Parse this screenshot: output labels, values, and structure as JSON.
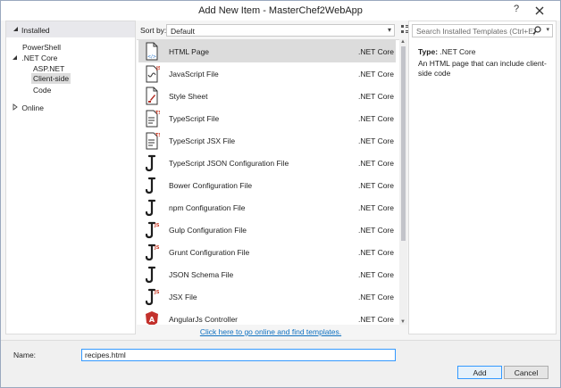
{
  "window": {
    "title": "Add New Item - MasterChef2WebApp",
    "help_label": "?"
  },
  "left": {
    "installed_label": "Installed",
    "tree": [
      {
        "label": "PowerShell"
      },
      {
        "label": ".NET Core"
      },
      {
        "label": "ASP.NET"
      },
      {
        "label": "Client-side"
      },
      {
        "label": "Code"
      },
      {
        "label": "Online"
      }
    ]
  },
  "toolbar": {
    "sort_label": "Sort by:",
    "sort_value": "Default"
  },
  "items": [
    {
      "name": "HTML Page",
      "category": ".NET Core",
      "icon": "html-page-icon"
    },
    {
      "name": "JavaScript File",
      "category": ".NET Core",
      "icon": "javascript-file-icon"
    },
    {
      "name": "Style Sheet",
      "category": ".NET Core",
      "icon": "style-sheet-icon"
    },
    {
      "name": "TypeScript File",
      "category": ".NET Core",
      "icon": "typescript-file-icon"
    },
    {
      "name": "TypeScript JSX File",
      "category": ".NET Core",
      "icon": "typescript-jsx-file-icon"
    },
    {
      "name": "TypeScript JSON Configuration File",
      "category": ".NET Core",
      "icon": "json-config-icon"
    },
    {
      "name": "Bower Configuration File",
      "category": ".NET Core",
      "icon": "json-config-icon"
    },
    {
      "name": "npm Configuration File",
      "category": ".NET Core",
      "icon": "json-config-icon"
    },
    {
      "name": "Gulp Configuration File",
      "category": ".NET Core",
      "icon": "js-config-icon"
    },
    {
      "name": "Grunt Configuration File",
      "category": ".NET Core",
      "icon": "js-config-icon"
    },
    {
      "name": "JSON Schema File",
      "category": ".NET Core",
      "icon": "json-config-icon"
    },
    {
      "name": "JSX File",
      "category": ".NET Core",
      "icon": "jsx-file-icon"
    },
    {
      "name": "AngularJs Controller",
      "category": ".NET Core",
      "icon": "angular-icon"
    }
  ],
  "details": {
    "search_placeholder": "Search Installed Templates (Ctrl+E)",
    "type_label": "Type:",
    "type_value": ".NET Core",
    "description": "An HTML page that can include client-side code"
  },
  "online_link": "Click here to go online and find templates.",
  "footer": {
    "name_label": "Name:",
    "name_value": "recipes.html",
    "add_label": "Add",
    "cancel_label": "Cancel"
  },
  "colors": {
    "selection": "#dcdcdc",
    "accent": "#3399ff",
    "link": "#0e70c0"
  }
}
